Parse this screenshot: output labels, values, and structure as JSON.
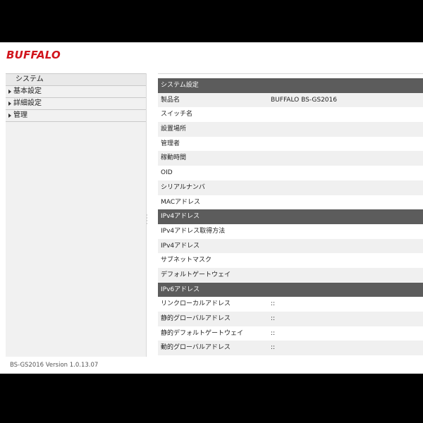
{
  "header": {
    "logo": "BUFFALO"
  },
  "menu": {
    "items": [
      {
        "label": "システム",
        "selected": true,
        "has_arrow": false
      },
      {
        "label": "基本設定",
        "selected": false,
        "has_arrow": true
      },
      {
        "label": "詳細設定",
        "selected": false,
        "has_arrow": true
      },
      {
        "label": "管理",
        "selected": false,
        "has_arrow": true
      }
    ]
  },
  "footer": {
    "version": "BS-GS2016 Version 1.0.13.07"
  },
  "rows": [
    {
      "type": "section",
      "label": "システム設定",
      "value": ""
    },
    {
      "type": "row",
      "label": "製品名",
      "value": "BUFFALO BS-GS2016"
    },
    {
      "type": "row",
      "label": "スイッチ名",
      "value": ""
    },
    {
      "type": "row",
      "label": "設置場所",
      "value": ""
    },
    {
      "type": "row",
      "label": "管理者",
      "value": ""
    },
    {
      "type": "row",
      "label": "稼動時間",
      "value": ""
    },
    {
      "type": "row",
      "label": "OID",
      "value": ""
    },
    {
      "type": "row",
      "label": "シリアルナンバ",
      "value": ""
    },
    {
      "type": "row",
      "label": "MACアドレス",
      "value": ""
    },
    {
      "type": "section",
      "label": "IPv4アドレス",
      "value": ""
    },
    {
      "type": "row",
      "label": "IPv4アドレス取得方法",
      "value": ""
    },
    {
      "type": "row",
      "label": "IPv4アドレス",
      "value": ""
    },
    {
      "type": "row",
      "label": "サブネットマスク",
      "value": ""
    },
    {
      "type": "row",
      "label": "デフォルトゲートウェイ",
      "value": ""
    },
    {
      "type": "section",
      "label": "IPv6アドレス",
      "value": ""
    },
    {
      "type": "row",
      "label": "リンクローカルアドレス",
      "value": "::"
    },
    {
      "type": "row",
      "label": "静的グローバルアドレス",
      "value": "::"
    },
    {
      "type": "row",
      "label": "静的デフォルトゲートウェイ",
      "value": "::"
    },
    {
      "type": "row",
      "label": "動的グローバルアドレス",
      "value": "::"
    }
  ]
}
